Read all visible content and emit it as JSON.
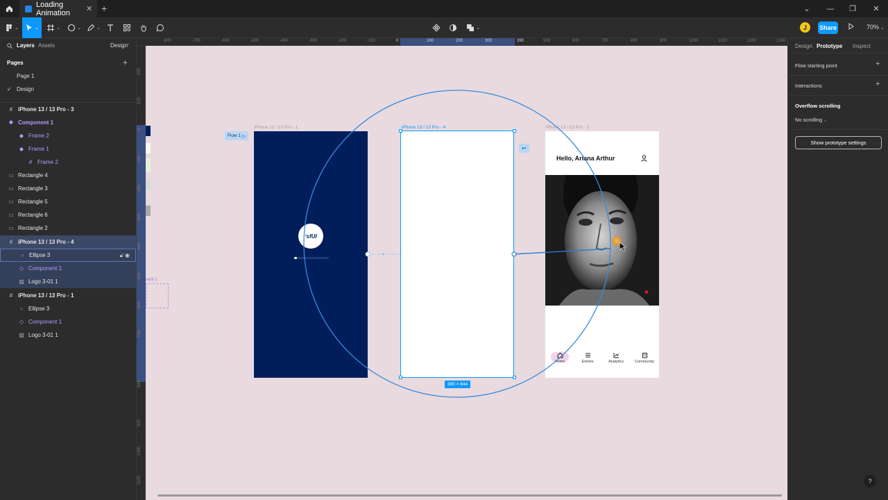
{
  "window": {
    "tab_title": "Loading Animation",
    "minimize": "—",
    "restore": "❐",
    "close": "✕",
    "dropdown": "⌄"
  },
  "toolbar": {
    "avatar_initial": "J",
    "share_label": "Share",
    "zoom": "70%"
  },
  "left_panel": {
    "tabs": {
      "layers": "Layers",
      "assets": "Assets",
      "design": "Design"
    },
    "pages_heading": "Pages",
    "pages": [
      {
        "label": "Page 1",
        "selected": false
      },
      {
        "label": "Design",
        "selected": true
      }
    ],
    "layers": [
      {
        "label": "iPhone 13 / 13 Pro - 3",
        "type": "frame"
      },
      {
        "label": "Component 1",
        "type": "component"
      },
      {
        "label": "Frame 2",
        "type": "instance"
      },
      {
        "label": "Frame 1",
        "type": "instance"
      },
      {
        "label": "Frame 2",
        "type": "frame-child"
      },
      {
        "label": "Rectangle 4",
        "type": "rect"
      },
      {
        "label": "Rectangle 3",
        "type": "rect"
      },
      {
        "label": "Rectangle 5",
        "type": "rect"
      },
      {
        "label": "Rectangle 6",
        "type": "rect"
      },
      {
        "label": "Rectangle 2",
        "type": "rect"
      },
      {
        "label": "iPhone 13 / 13 Pro - 4",
        "type": "frame"
      },
      {
        "label": "Ellipse 3",
        "type": "ellipse"
      },
      {
        "label": "Component 1",
        "type": "instance"
      },
      {
        "label": "Logo 3-01 1",
        "type": "image"
      },
      {
        "label": "iPhone 13 / 13 Pro - 1",
        "type": "frame"
      },
      {
        "label": "Ellipse 3",
        "type": "ellipse"
      },
      {
        "label": "Component 1",
        "type": "instance"
      },
      {
        "label": "Logo 3-01 1",
        "type": "image"
      }
    ]
  },
  "rulers": {
    "top": [
      "-800",
      "-700",
      "-600",
      "-500",
      "-400",
      "-300",
      "-200",
      "-100",
      "0",
      "100",
      "200",
      "300",
      "390",
      "500",
      "600",
      "700",
      "800",
      "900",
      "1000",
      "1100",
      "1200",
      "1300"
    ],
    "left": [
      "-200",
      "-100",
      "0",
      "100",
      "200",
      "300",
      "400",
      "500",
      "600",
      "700",
      "844",
      "900",
      "1000",
      "1100",
      "1200"
    ]
  },
  "canvas": {
    "flow_label": "Flow 1",
    "frame1_label": "iPhone 13 / 13 Pro - 1",
    "frame4_label": "iPhone 13 / 13 Pro - 4",
    "frame3_label": "iPhone 13 / 13 Pro - 3",
    "logo_text": "ʻsfUI",
    "loading_progress": 0.08,
    "greeting": "Hello, Ariana Arthur",
    "nav": [
      {
        "label": "Home",
        "icon": "home-icon"
      },
      {
        "label": "Entries",
        "icon": "list-icon"
      },
      {
        "label": "Analytics",
        "icon": "chart-icon"
      },
      {
        "label": "Community",
        "icon": "building-icon"
      }
    ],
    "size_badge": "390 × 844",
    "ghost_label": "nent 1",
    "back_icon": "↩"
  },
  "right_panel": {
    "tabs": {
      "design": "Design",
      "prototype": "Prototype",
      "inspect": "Inspect"
    },
    "flow_start": "Flow starting point",
    "interactions": "Interactions",
    "overflow_heading": "Overflow scrolling",
    "overflow_value": "No scrolling",
    "proto_settings": "Show prototype settings"
  },
  "help": "?",
  "colors": {
    "accent": "#0d99ff",
    "canvas_bg": "#e8dadf",
    "splash_bg": "#011e5a",
    "component_purple": "#b59bff",
    "heart": "#e0201c"
  }
}
